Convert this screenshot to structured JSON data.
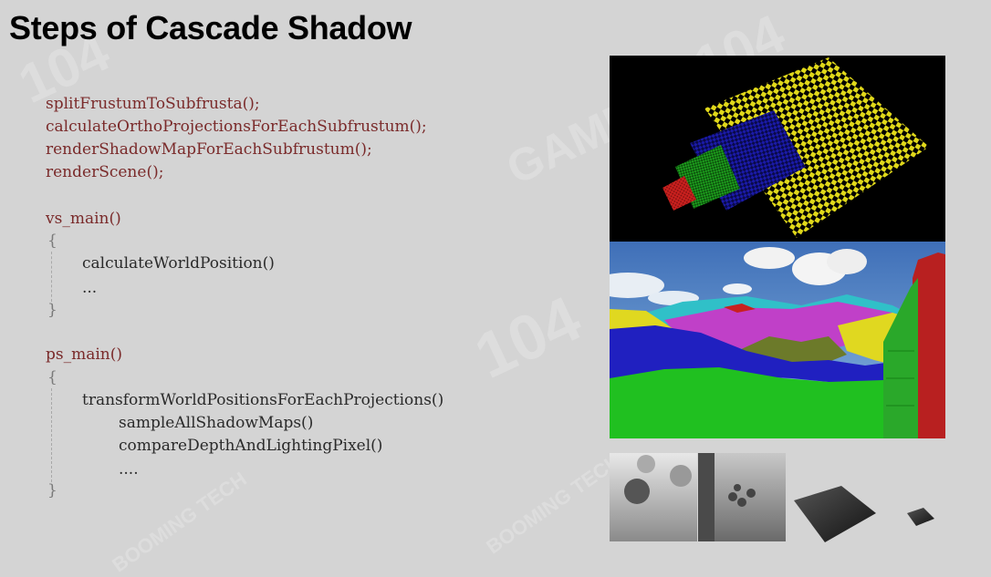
{
  "slide": {
    "title": "Steps of Cascade Shadow"
  },
  "code": {
    "l1": "splitFrustumToSubfrusta();",
    "l2": "calculateOrthoProjectionsForEachSubfrustum();",
    "l3": "renderShadowMapForEachSubfrustum();",
    "l4": "renderScene();",
    "l5": "vs_main()",
    "l6": "{",
    "l7": "calculateWorldPosition()",
    "l8": "...",
    "l9": "}",
    "l10": "ps_main()",
    "l11": "{",
    "l12": "transformWorldPositionsForEachProjections()",
    "l13": "sampleAllShadowMaps()",
    "l14": "compareDepthAndLightingPixel()",
    "l15": "....",
    "l16": "}"
  },
  "watermark": {
    "brand": "BOOMING TECH",
    "number": "104",
    "games": "GAMES"
  },
  "colors": {
    "background": "#d4d4d4",
    "code_red": "#7a2a2a",
    "cascade_red": "#c8201e",
    "cascade_green": "#1ea01e",
    "cascade_blue": "#1a1aa8",
    "cascade_yellow": "#e0d81a"
  }
}
